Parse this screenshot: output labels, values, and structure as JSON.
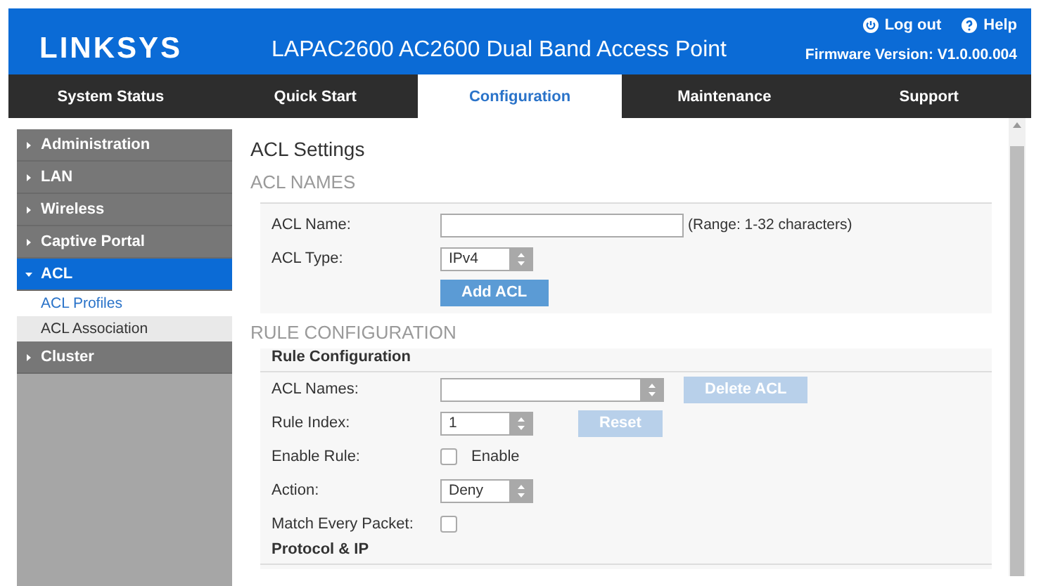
{
  "header": {
    "logo": "LINKSYS",
    "title": "LAPAC2600 AC2600 Dual Band Access Point",
    "firmware": "Firmware Version: V1.0.00.004",
    "links": [
      {
        "kind": "logout",
        "label": "Log out"
      },
      {
        "kind": "help",
        "label": "Help"
      }
    ]
  },
  "nav": [
    {
      "label": "System Status",
      "selected": false
    },
    {
      "label": "Quick Start",
      "selected": false
    },
    {
      "label": "Configuration",
      "selected": true
    },
    {
      "label": "Maintenance",
      "selected": false
    },
    {
      "label": "Support",
      "selected": false
    }
  ],
  "sidebar": [
    {
      "label": "Administration",
      "expanded": false,
      "selected": false
    },
    {
      "label": "LAN",
      "expanded": false,
      "selected": false
    },
    {
      "label": "Wireless",
      "expanded": false,
      "selected": false
    },
    {
      "label": "Captive Portal",
      "expanded": false,
      "selected": false
    },
    {
      "label": "ACL",
      "expanded": true,
      "selected": true,
      "children": [
        {
          "label": "ACL Profiles",
          "selected": true
        },
        {
          "label": "ACL Association",
          "selected": false
        }
      ]
    },
    {
      "label": "Cluster",
      "expanded": false,
      "selected": false
    }
  ],
  "page": {
    "title": "ACL Settings",
    "sections": [
      {
        "heading": "ACL NAMES",
        "groups": [
          {
            "rows": [
              {
                "kind": "text",
                "label": "ACL Name:",
                "value": "",
                "hint": "(Range: 1-32 characters)"
              },
              {
                "kind": "select",
                "label": "ACL Type:",
                "value": "IPv4"
              },
              {
                "kind": "button",
                "action": {
                  "label": "Add ACL",
                  "disabled": false
                }
              }
            ]
          }
        ]
      },
      {
        "heading": "RULE CONFIGURATION",
        "groups": [
          {
            "title": "Rule Configuration",
            "rows": [
              {
                "kind": "dropdown",
                "label": "ACL Names:",
                "value": "",
                "action": {
                  "label": "Delete ACL",
                  "disabled": true
                }
              },
              {
                "kind": "select",
                "label": "Rule Index:",
                "value": "1",
                "action": {
                  "label": "Reset",
                  "disabled": true
                }
              },
              {
                "kind": "checkbox",
                "label": "Enable Rule:",
                "checked": false,
                "text": "Enable"
              },
              {
                "kind": "select",
                "label": "Action:",
                "value": "Deny"
              },
              {
                "kind": "checkbox",
                "label": "Match Every Packet:",
                "checked": false
              }
            ]
          },
          {
            "title": "Protocol & IP"
          }
        ]
      }
    ]
  }
}
